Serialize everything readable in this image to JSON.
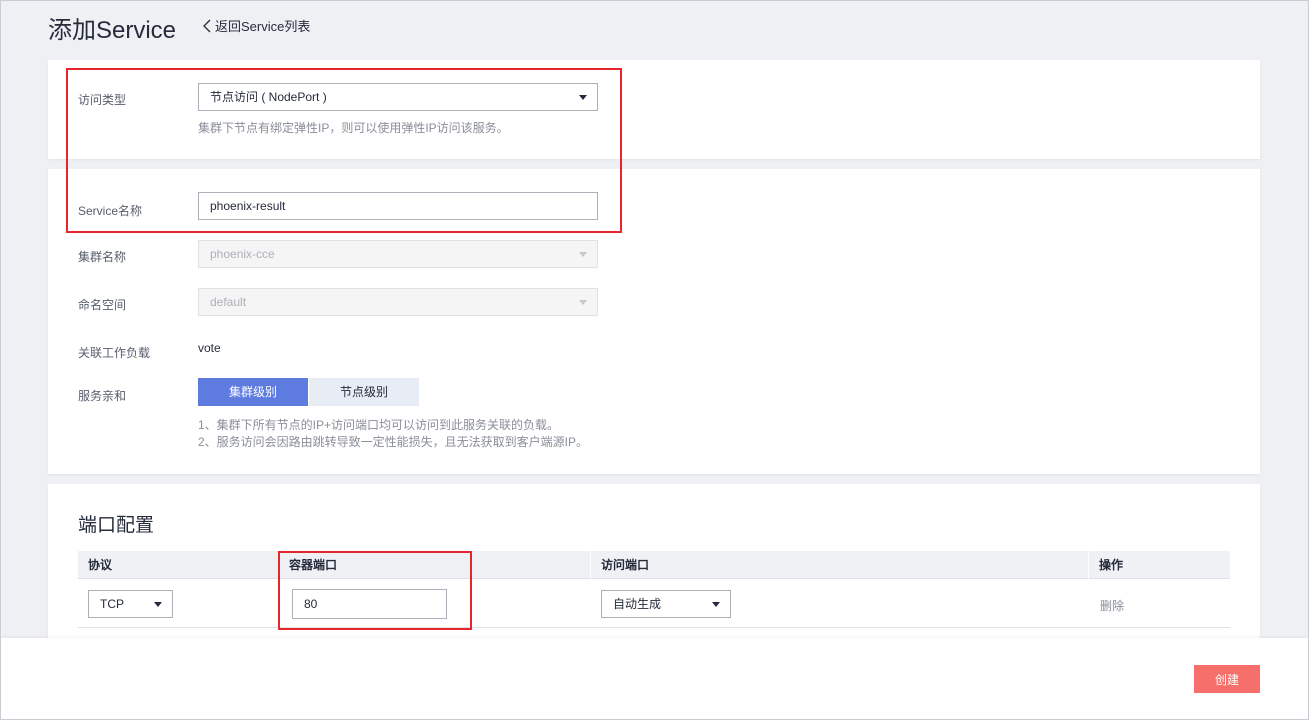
{
  "header": {
    "title": "添加Service",
    "back_link": "返回Service列表"
  },
  "access_type": {
    "label": "访问类型",
    "value": "节点访问 ( NodePort )",
    "hint": "集群下节点有绑定弹性IP，则可以使用弹性IP访问该服务。"
  },
  "form": {
    "service_name": {
      "label": "Service名称",
      "value": "phoenix-result"
    },
    "cluster_name": {
      "label": "集群名称",
      "value": "phoenix-cce"
    },
    "namespace": {
      "label": "命名空间",
      "value": "default"
    },
    "workload": {
      "label": "关联工作负载",
      "value": "vote"
    },
    "affinity": {
      "label": "服务亲和",
      "options": [
        "集群级别",
        "节点级别"
      ],
      "selected": "集群级别",
      "hint_lines": [
        "1、集群下所有节点的IP+访问端口均可以访问到此服务关联的负载。",
        "2、服务访问会因路由跳转导致一定性能损失，且无法获取到客户端源IP。"
      ]
    }
  },
  "ports": {
    "title": "端口配置",
    "columns": [
      "协议",
      "容器端口",
      "访问端口",
      "操作"
    ],
    "rows": [
      {
        "protocol": "TCP",
        "container_port": "80",
        "access_port": "自动生成",
        "action": "删除"
      }
    ]
  },
  "footer": {
    "create_label": "创建"
  },
  "colors": {
    "primary": "#5e7ce0",
    "danger": "#f66f6a",
    "highlight": "#e5262d"
  }
}
